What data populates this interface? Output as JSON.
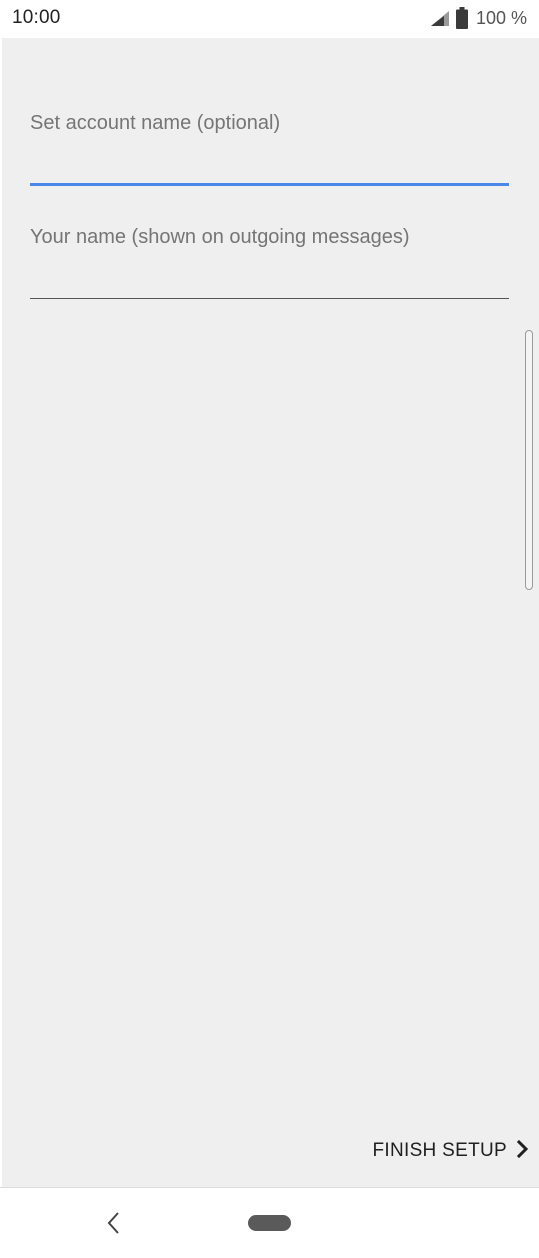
{
  "status_bar": {
    "time": "10:00",
    "battery_text": "100 %",
    "icons": [
      "signal-icon",
      "battery-icon"
    ]
  },
  "form": {
    "account_name": {
      "label": "Set account name (optional)",
      "value": ""
    },
    "your_name": {
      "label": "Your name (shown on outgoing messages)",
      "value": ""
    }
  },
  "actions": {
    "finish_label": "FINISH SETUP",
    "finish_icon": "chevron-right-icon"
  },
  "navigation": {
    "icons": [
      "back-icon",
      "home-pill-icon"
    ]
  },
  "colors": {
    "accent": "#4a86e8",
    "background": "#efefef"
  }
}
